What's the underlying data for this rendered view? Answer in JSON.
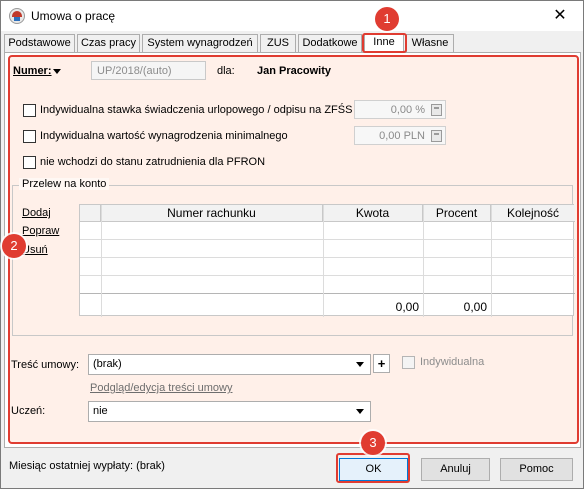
{
  "window": {
    "title": "Umowa o pracę",
    "close_glyph": "✕"
  },
  "tabs": [
    {
      "label": "Podstawowe"
    },
    {
      "label": "Czas pracy"
    },
    {
      "label": "System wynagrodzeń"
    },
    {
      "label": "ZUS"
    },
    {
      "label": "Dodatkowe"
    },
    {
      "label": "Inne",
      "active": true
    },
    {
      "label": "Własne"
    }
  ],
  "header": {
    "numer_label": "Numer:",
    "numer_value": "UP/2018/(auto)",
    "dla_label": "dla:",
    "employee": "Jan Pracowity"
  },
  "checkboxes": [
    {
      "label": "Indywidualna stawka świadczenia urlopowego / odpisu na ZFŚS",
      "checked": false,
      "value": "0,00 %"
    },
    {
      "label": "Indywidualna wartość wynagrodzenia minimalnego",
      "checked": false,
      "value": "0,00 PLN"
    },
    {
      "label": "nie wchodzi do stanu zatrudnienia dla PFRON",
      "checked": false
    }
  ],
  "transfer": {
    "group_title": "Przelew na konto",
    "actions": {
      "add": "Dodaj",
      "edit": "Popraw",
      "delete": "Usuń"
    },
    "columns": [
      "Numer rachunku",
      "Kwota",
      "Procent",
      "Kolejność"
    ],
    "totals": {
      "kwota": "0,00",
      "procent": "0,00"
    }
  },
  "form": {
    "tresc_label": "Treść umowy:",
    "tresc_value": "(brak)",
    "plus_glyph": "+",
    "indywidualna_label": "Indywidualna",
    "podglad_link": "Podgląd/edycja treści umowy",
    "uczen_label": "Uczeń:",
    "uczen_value": "nie"
  },
  "footer": {
    "status": "Miesiąc ostatniej wypłaty: (brak)",
    "ok": "OK",
    "cancel": "Anuluj",
    "help": "Pomoc"
  },
  "badges": [
    "1",
    "2",
    "3"
  ],
  "colors": {
    "highlight": "#e03c31",
    "panel_tint": "#fff0e8"
  }
}
